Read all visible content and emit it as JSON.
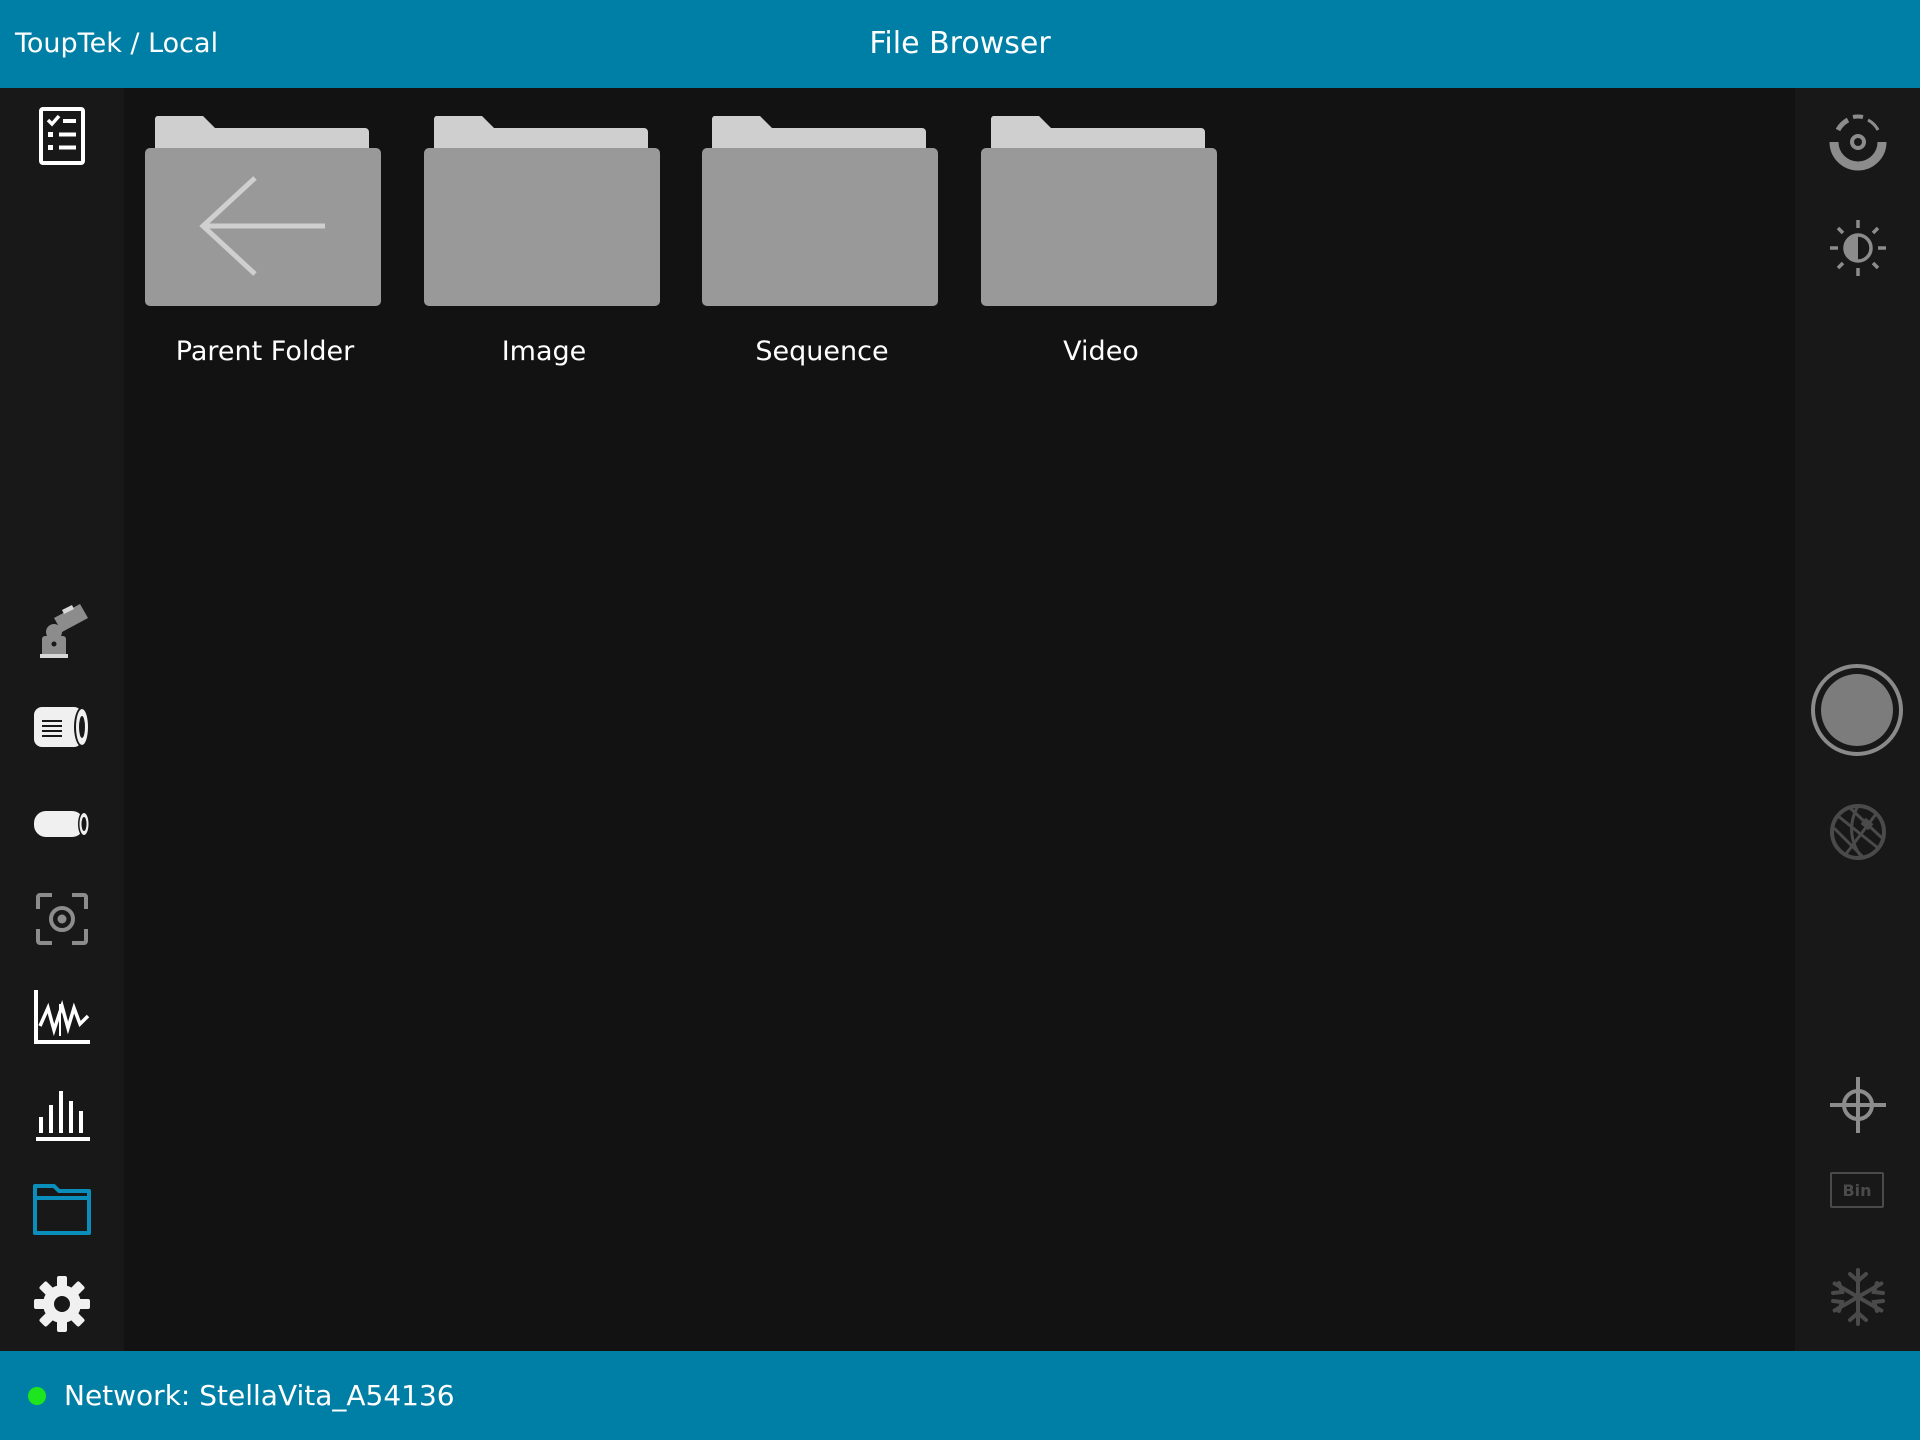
{
  "header": {
    "breadcrumb": "ToupTek / Local",
    "title": "File Browser"
  },
  "folders": [
    {
      "name": "Parent Folder",
      "icon": "back-arrow-icon"
    },
    {
      "name": "Image",
      "icon": "folder-icon"
    },
    {
      "name": "Sequence",
      "icon": "folder-icon"
    },
    {
      "name": "Video",
      "icon": "folder-icon"
    }
  ],
  "left_sidebar": {
    "items": [
      {
        "id": "task-list",
        "icon": "checklist-icon"
      },
      {
        "id": "telescope",
        "icon": "telescope-icon"
      },
      {
        "id": "focuser",
        "icon": "focuser-icon"
      },
      {
        "id": "filter-wheel",
        "icon": "filter-icon"
      },
      {
        "id": "focus-assist",
        "icon": "focus-target-icon"
      },
      {
        "id": "graph",
        "icon": "waveform-chart-icon"
      },
      {
        "id": "histogram",
        "icon": "histogram-icon"
      },
      {
        "id": "file-browser",
        "icon": "folder-icon",
        "active": true
      },
      {
        "id": "settings",
        "icon": "gear-icon"
      }
    ]
  },
  "right_sidebar": {
    "items": [
      {
        "id": "exposure",
        "icon": "exposure-dial-icon"
      },
      {
        "id": "brightness",
        "icon": "brightness-icon"
      },
      {
        "id": "capture",
        "icon": "shutter-icon"
      },
      {
        "id": "plate-solve",
        "icon": "globe-grid-icon"
      },
      {
        "id": "crosshair",
        "icon": "crosshair-icon"
      },
      {
        "id": "binning",
        "icon": "bin-icon",
        "label": "Bin"
      },
      {
        "id": "cooler",
        "icon": "snowflake-icon"
      }
    ]
  },
  "status": {
    "network_label": "Network: StellaVita_A54136",
    "connected": true
  },
  "colors": {
    "accent": "#007fa6",
    "background": "#121212",
    "sidebar": "#181818",
    "status_ok": "#1ee61e",
    "active_icon": "#0a8fbd"
  }
}
